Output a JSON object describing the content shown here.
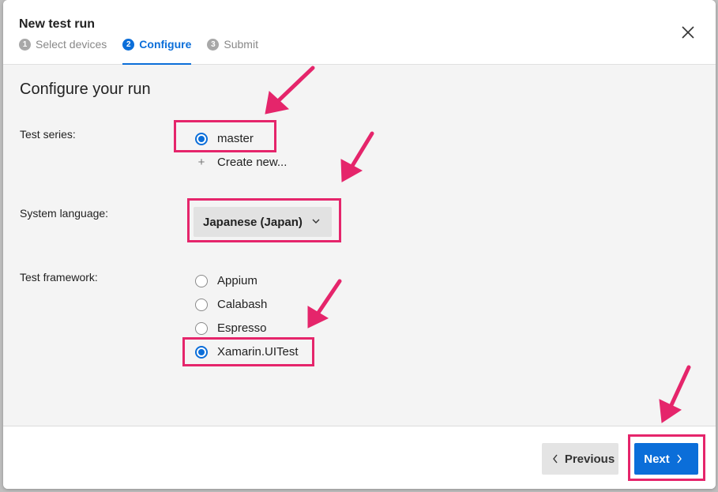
{
  "dialog": {
    "title": "New test run",
    "steps": [
      {
        "num": "1",
        "label": "Select devices",
        "state": "inactive"
      },
      {
        "num": "2",
        "label": "Configure",
        "state": "active"
      },
      {
        "num": "3",
        "label": "Submit",
        "state": "inactive"
      }
    ],
    "close_icon": "close-icon"
  },
  "content": {
    "heading": "Configure your run",
    "test_series": {
      "label": "Test series:",
      "options": [
        {
          "label": "master",
          "selected": true
        }
      ],
      "create_new": "Create new..."
    },
    "system_language": {
      "label": "System language:",
      "selected": "Japanese (Japan)"
    },
    "test_framework": {
      "label": "Test framework:",
      "options": [
        {
          "label": "Appium",
          "selected": false
        },
        {
          "label": "Calabash",
          "selected": false
        },
        {
          "label": "Espresso",
          "selected": false
        },
        {
          "label": "Xamarin.UITest",
          "selected": true
        }
      ]
    }
  },
  "footer": {
    "previous_label": "Previous",
    "next_label": "Next"
  },
  "colors": {
    "accent": "#0b6ed9",
    "annotation": "#e5256b"
  }
}
